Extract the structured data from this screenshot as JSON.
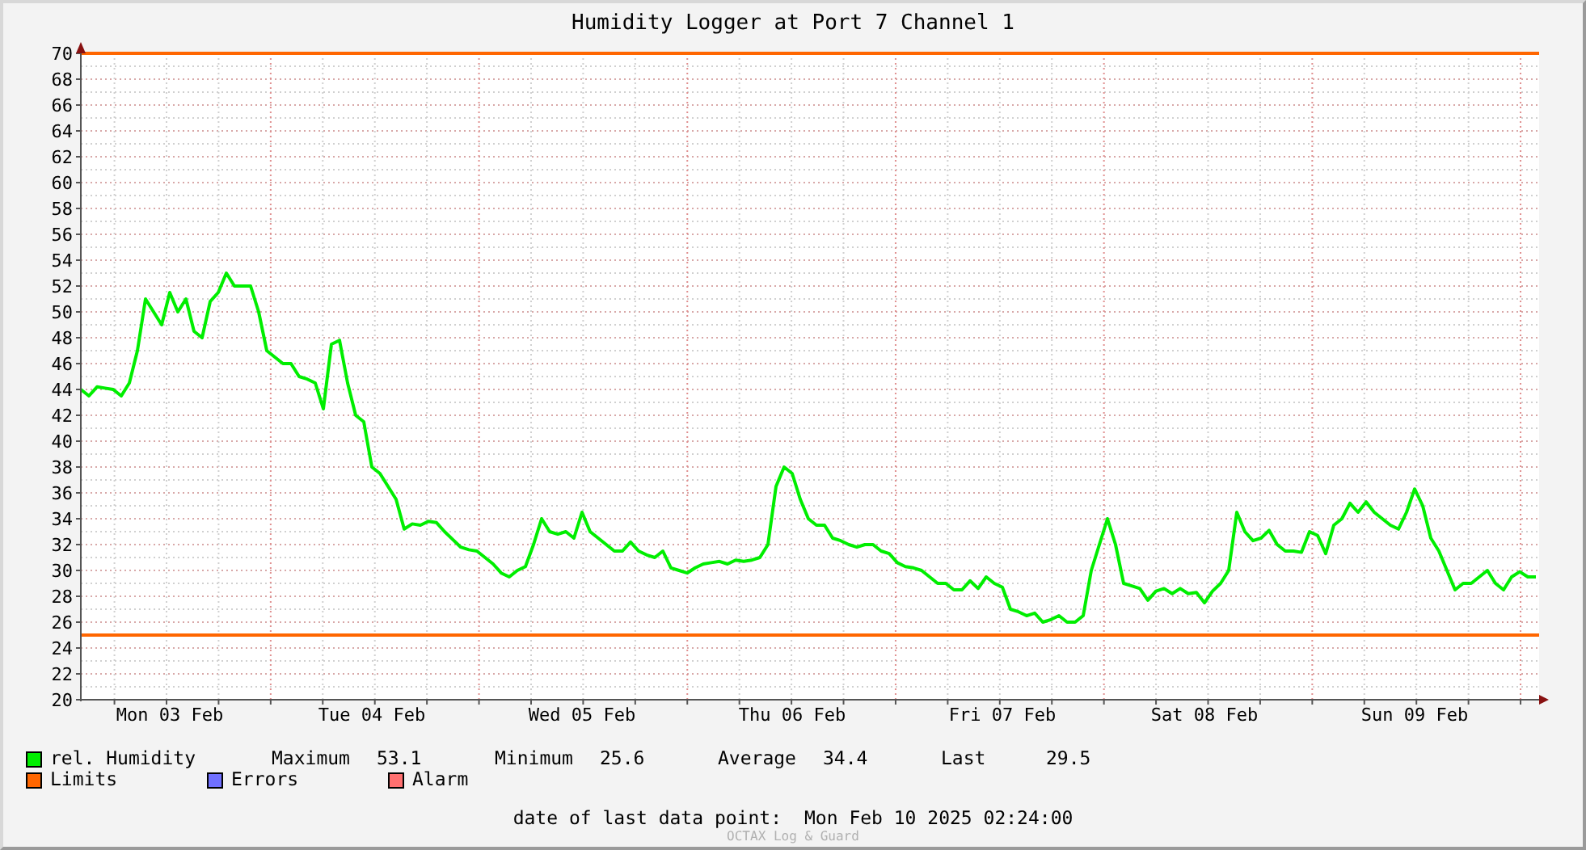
{
  "chart": {
    "chart_data": {
      "type": "line",
      "title": "Humidity Logger at Port 7 Channel 1",
      "categories": [
        null,
        null,
        null,
        null,
        null,
        null,
        null,
        null,
        null,
        null,
        null,
        "Mon 03 Feb",
        null,
        null,
        null,
        null,
        null,
        null,
        null,
        null,
        null,
        null,
        null,
        null,
        null,
        null,
        null,
        null,
        null,
        null,
        null,
        null,
        null,
        null,
        null,
        null,
        "Tue 04 Feb",
        null,
        null,
        null,
        null,
        null,
        null,
        null,
        null,
        null,
        null,
        null,
        null,
        null,
        null,
        null,
        null,
        null,
        null,
        null,
        null,
        null,
        null,
        null,
        null,
        null,
        "Wed 05 Feb",
        null,
        null,
        null,
        null,
        null,
        null,
        null,
        null,
        null,
        null,
        null,
        null,
        null,
        null,
        null,
        null,
        null,
        null,
        null,
        null,
        null,
        null,
        null,
        null,
        null,
        "Thu 06 Feb",
        null,
        null,
        null,
        null,
        null,
        null,
        null,
        null,
        null,
        null,
        null,
        null,
        null,
        null,
        null,
        null,
        null,
        null,
        null,
        null,
        null,
        null,
        null,
        null,
        null,
        "Fri 07 Feb",
        null,
        null,
        null,
        null,
        null,
        null,
        null,
        null,
        null,
        null,
        null,
        null,
        null,
        null,
        null,
        null,
        null,
        null,
        null,
        null,
        null,
        null,
        null,
        null,
        "Sat 08 Feb",
        null,
        null,
        null,
        null,
        null,
        null,
        null,
        null,
        null,
        null,
        null,
        null,
        null,
        null,
        null,
        null,
        null,
        null,
        null,
        null,
        null,
        null,
        null,
        null,
        null,
        "Sun 09 Feb",
        null,
        null,
        null,
        null,
        null,
        null,
        null,
        null,
        null,
        null,
        null,
        null,
        null,
        null,
        null
      ],
      "series": [
        {
          "name": "rel. Humidity",
          "color": "#00ee00",
          "values": [
            44,
            43.5,
            44.2,
            44.1,
            44,
            43.5,
            44.5,
            47,
            51,
            50,
            49,
            51.5,
            50,
            51,
            48.5,
            48,
            50.8,
            51.5,
            53,
            52,
            52,
            52,
            50,
            47,
            46.5,
            46,
            46,
            45,
            44.8,
            44.5,
            42.5,
            47.5,
            47.8,
            44.5,
            42,
            41.5,
            38,
            37.5,
            36.5,
            35.5,
            33.2,
            33.6,
            33.5,
            33.8,
            33.7,
            33,
            32.4,
            31.8,
            31.6,
            31.5,
            31,
            30.5,
            29.8,
            29.5,
            30,
            30.3,
            32,
            34,
            33,
            32.8,
            33,
            32.5,
            34.5,
            33,
            32.5,
            32,
            31.5,
            31.5,
            32.2,
            31.5,
            31.2,
            31,
            31.5,
            30.2,
            30,
            29.8,
            30.2,
            30.5,
            30.6,
            30.7,
            30.5,
            30.8,
            30.7,
            30.8,
            31,
            32,
            36.5,
            38,
            37.5,
            35.5,
            34,
            33.5,
            33.5,
            32.5,
            32.3,
            32,
            31.8,
            32,
            32,
            31.5,
            31.3,
            30.6,
            30.3,
            30.2,
            30,
            29.5,
            29,
            29,
            28.5,
            28.5,
            29.2,
            28.6,
            29.5,
            29,
            28.7,
            27,
            26.8,
            26.5,
            26.7,
            26,
            26.2,
            26.5,
            26,
            26,
            26.5,
            30,
            32,
            34,
            32,
            29,
            28.8,
            28.6,
            27.7,
            28.4,
            28.6,
            28.2,
            28.6,
            28.2,
            28.3,
            27.5,
            28.4,
            29,
            30,
            34.5,
            33,
            32.3,
            32.5,
            33.1,
            32,
            31.5,
            31.5,
            31.4,
            33,
            32.7,
            31.3,
            33.5,
            34,
            35.2,
            34.5,
            35.3,
            34.5,
            34,
            33.5,
            33.2,
            34.5,
            36.3,
            35,
            32.5,
            31.5,
            30,
            28.5,
            29,
            29,
            29.5,
            30,
            29,
            28.5,
            29.5,
            29.9,
            29.5,
            29.5
          ]
        }
      ],
      "ylim": [
        20,
        70
      ],
      "yticks": [
        20,
        22,
        24,
        26,
        28,
        30,
        32,
        34,
        36,
        38,
        40,
        42,
        44,
        46,
        48,
        50,
        52,
        54,
        56,
        58,
        60,
        62,
        64,
        66,
        68,
        70
      ],
      "grid": true,
      "ref_lines": [
        {
          "axis": "y",
          "value": 70
        },
        {
          "axis": "y",
          "value": 25
        }
      ]
    }
  },
  "legend": [
    {
      "label": "Limits",
      "color": "#ff6600"
    },
    {
      "label": "Errors",
      "color": "#7070ff"
    },
    {
      "label": "Alarm",
      "color": "#ff7070"
    }
  ],
  "stats": [
    {
      "label": "Maximum",
      "value": "53.1"
    },
    {
      "label": "Minimum",
      "value": "25.6"
    },
    {
      "label": "Average",
      "value": "34.4"
    },
    {
      "label": "Last",
      "value": "29.5"
    }
  ],
  "footer": {
    "label": "date of last data point:",
    "value": "Mon Feb 10 2025 02:24:00",
    "credit": "OCTAX Log & Guard"
  }
}
